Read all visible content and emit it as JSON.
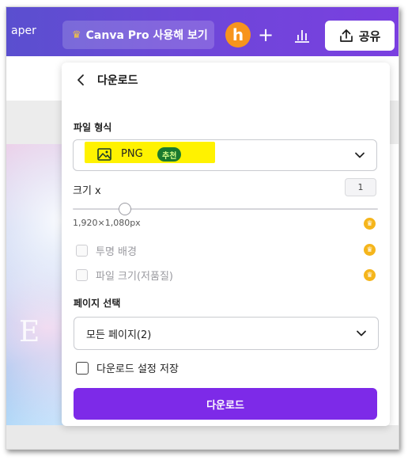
{
  "topbar": {
    "left_text": "aper",
    "pro_button_label": "Canva Pro 사용해 보기",
    "avatar_initial": "h",
    "plus_label": "+",
    "share_label": "공유"
  },
  "panel": {
    "title": "다운로드",
    "file_type": {
      "label": "파일 형식",
      "value": "PNG",
      "badge": "추천"
    },
    "size": {
      "label": "크기 x",
      "value": "1",
      "slider_fraction": 0.17,
      "resolution": "1,920×1,080px"
    },
    "options": [
      {
        "label": "투명 배경",
        "checked": false,
        "pro": true
      },
      {
        "label": "파일 크기(저품질)",
        "checked": false,
        "pro": true
      }
    ],
    "pages": {
      "label": "페이지 선택",
      "value": "모든 페이지(2)"
    },
    "save_settings": {
      "label": "다운로드 설정 저장",
      "checked": false
    },
    "download_button": "다운로드"
  },
  "colors": {
    "topbar_start": "#5a4fcf",
    "topbar_end": "#7a3fe0",
    "accent": "#7d2ae8",
    "avatar": "#f7941d",
    "highlight": "#fff200",
    "badge_bg": "#1b7a2f",
    "pro_crown": "#f5b51b"
  },
  "icons": {
    "pro_button": "crown-icon",
    "analytics": "bar-chart-icon",
    "share": "upload-icon",
    "back": "chevron-left-icon",
    "file_type": "image-icon",
    "dropdown": "chevron-down-icon",
    "pro_feature": "crown-icon"
  }
}
